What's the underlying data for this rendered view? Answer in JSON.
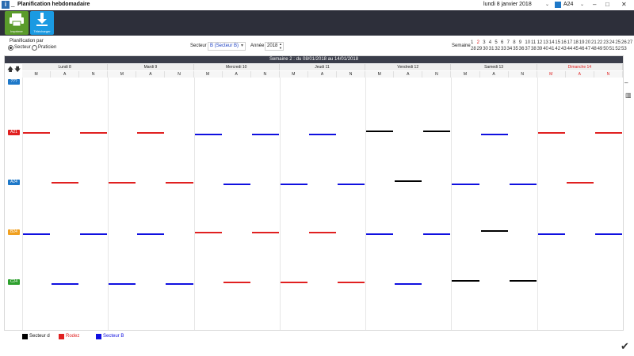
{
  "titlebar": {
    "title": "Planification hebdomadaire",
    "date": "lundi 8 janvier 2018",
    "user": "A24",
    "minimize": "–",
    "restore": "□",
    "close": "✕",
    "caret": "⌄"
  },
  "toolbar": {
    "print_label": "Imprimer",
    "download_label": "Télécharger",
    "print_color": "#5a9b2b",
    "download_color": "#1a9ae2"
  },
  "filters": {
    "plan_by_label": "Planification par",
    "opt_sector": "Secteur",
    "opt_practitioner": "Praticien",
    "sector_label": "Secteur",
    "sector_value": "B (Secteur B)",
    "year_label": "Année",
    "year_value": "2018",
    "weeks_label": "Semaine",
    "weeks_row1": [
      "1",
      "2",
      "3",
      "4",
      "5",
      "6",
      "7",
      "8",
      "9",
      "10",
      "11",
      "12",
      "13",
      "14",
      "15",
      "16",
      "17",
      "18",
      "19",
      "20",
      "21",
      "22",
      "23",
      "24",
      "25",
      "26",
      "27"
    ],
    "weeks_row2": [
      "28",
      "29",
      "30",
      "31",
      "32",
      "33",
      "34",
      "35",
      "36",
      "37",
      "38",
      "39",
      "40",
      "41",
      "42",
      "43",
      "44",
      "45",
      "46",
      "47",
      "48",
      "49",
      "50",
      "51",
      "52",
      "53"
    ],
    "current_week": "2"
  },
  "schedule": {
    "week_title": "Semaine 2 : du 08/01/2018 au 14/01/2018",
    "days": [
      "Lundi 8",
      "Mardi 9",
      "Mercredi 10",
      "Jeudi 11",
      "Vendredi 12",
      "Samedi 13",
      "Dimanche 14"
    ],
    "shifts": [
      "M",
      "A",
      "N"
    ],
    "rows": [
      {
        "label": "???",
        "color": "#1e78c8"
      },
      {
        "label": "A21",
        "color": "#e02020"
      },
      {
        "label": "A24",
        "color": "#1e78c8"
      },
      {
        "label": "B24",
        "color": "#f0a020"
      },
      {
        "label": "C24",
        "color": "#2ea02e"
      }
    ],
    "assignments": [
      {
        "row": 1,
        "day": 0,
        "shift": 0,
        "sector": "Rodez"
      },
      {
        "row": 1,
        "day": 0,
        "shift": 2,
        "sector": "Rodez"
      },
      {
        "row": 1,
        "day": 1,
        "shift": 1,
        "sector": "Rodez"
      },
      {
        "row": 1,
        "day": 2,
        "shift": 0,
        "sector": "Secteur B"
      },
      {
        "row": 1,
        "day": 2,
        "shift": 2,
        "sector": "Secteur B"
      },
      {
        "row": 1,
        "day": 3,
        "shift": 1,
        "sector": "Secteur B"
      },
      {
        "row": 1,
        "day": 4,
        "shift": 0,
        "sector": "Secteur d"
      },
      {
        "row": 1,
        "day": 4,
        "shift": 2,
        "sector": "Secteur d"
      },
      {
        "row": 1,
        "day": 5,
        "shift": 1,
        "sector": "Secteur B"
      },
      {
        "row": 1,
        "day": 6,
        "shift": 0,
        "sector": "Rodez"
      },
      {
        "row": 1,
        "day": 6,
        "shift": 2,
        "sector": "Rodez"
      },
      {
        "row": 2,
        "day": 0,
        "shift": 1,
        "sector": "Rodez"
      },
      {
        "row": 2,
        "day": 1,
        "shift": 0,
        "sector": "Rodez"
      },
      {
        "row": 2,
        "day": 1,
        "shift": 2,
        "sector": "Rodez"
      },
      {
        "row": 2,
        "day": 2,
        "shift": 1,
        "sector": "Secteur B"
      },
      {
        "row": 2,
        "day": 3,
        "shift": 0,
        "sector": "Secteur B"
      },
      {
        "row": 2,
        "day": 3,
        "shift": 2,
        "sector": "Secteur B"
      },
      {
        "row": 2,
        "day": 4,
        "shift": 1,
        "sector": "Secteur d"
      },
      {
        "row": 2,
        "day": 5,
        "shift": 0,
        "sector": "Secteur B"
      },
      {
        "row": 2,
        "day": 5,
        "shift": 2,
        "sector": "Secteur B"
      },
      {
        "row": 2,
        "day": 6,
        "shift": 1,
        "sector": "Rodez"
      },
      {
        "row": 3,
        "day": 0,
        "shift": 0,
        "sector": "Secteur B"
      },
      {
        "row": 3,
        "day": 0,
        "shift": 2,
        "sector": "Secteur B"
      },
      {
        "row": 3,
        "day": 1,
        "shift": 1,
        "sector": "Secteur B"
      },
      {
        "row": 3,
        "day": 2,
        "shift": 0,
        "sector": "Rodez"
      },
      {
        "row": 3,
        "day": 2,
        "shift": 2,
        "sector": "Rodez"
      },
      {
        "row": 3,
        "day": 3,
        "shift": 1,
        "sector": "Rodez"
      },
      {
        "row": 3,
        "day": 4,
        "shift": 0,
        "sector": "Secteur B"
      },
      {
        "row": 3,
        "day": 4,
        "shift": 2,
        "sector": "Secteur B"
      },
      {
        "row": 3,
        "day": 5,
        "shift": 1,
        "sector": "Secteur d"
      },
      {
        "row": 3,
        "day": 6,
        "shift": 0,
        "sector": "Secteur B"
      },
      {
        "row": 3,
        "day": 6,
        "shift": 2,
        "sector": "Secteur B"
      },
      {
        "row": 4,
        "day": 0,
        "shift": 1,
        "sector": "Secteur B"
      },
      {
        "row": 4,
        "day": 1,
        "shift": 0,
        "sector": "Secteur B"
      },
      {
        "row": 4,
        "day": 1,
        "shift": 2,
        "sector": "Secteur B"
      },
      {
        "row": 4,
        "day": 2,
        "shift": 1,
        "sector": "Rodez"
      },
      {
        "row": 4,
        "day": 3,
        "shift": 0,
        "sector": "Rodez"
      },
      {
        "row": 4,
        "day": 3,
        "shift": 2,
        "sector": "Rodez"
      },
      {
        "row": 4,
        "day": 4,
        "shift": 1,
        "sector": "Secteur B"
      },
      {
        "row": 4,
        "day": 5,
        "shift": 0,
        "sector": "Secteur d"
      },
      {
        "row": 4,
        "day": 5,
        "shift": 2,
        "sector": "Secteur d"
      }
    ]
  },
  "legend": [
    {
      "label": "Secteur d",
      "color": "#000000"
    },
    {
      "label": "Rodez",
      "color": "#e02020"
    },
    {
      "label": "Secteur B",
      "color": "#1010e0"
    }
  ],
  "icons": {
    "up_arrow": "🡅",
    "down_arrow": "🡇",
    "minus": "–",
    "grid": "▥",
    "check": "✔"
  }
}
